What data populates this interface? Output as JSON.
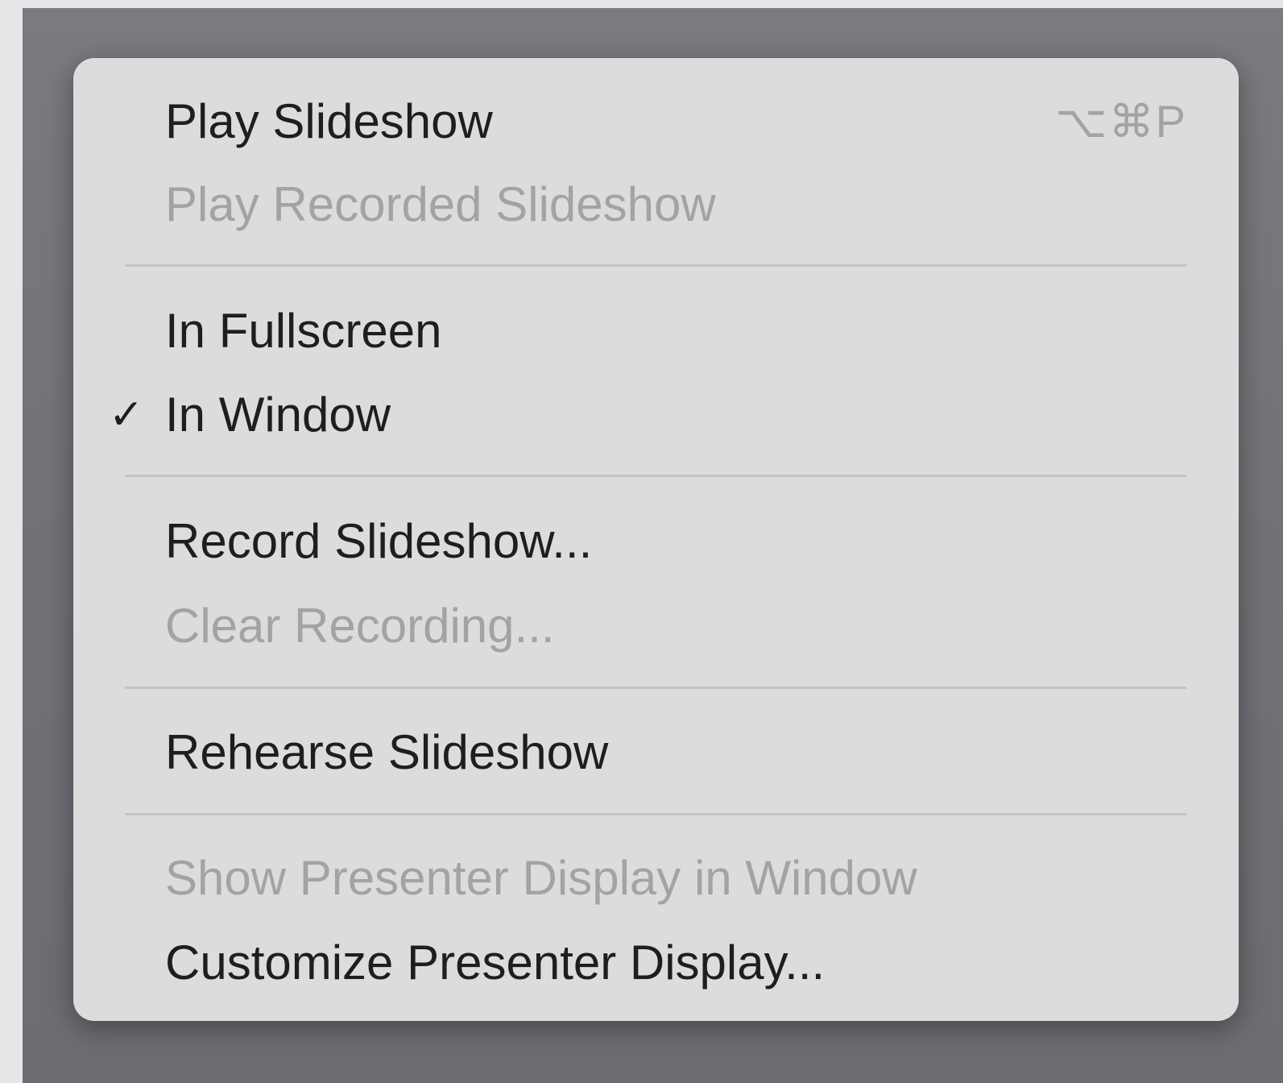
{
  "menu": {
    "items": [
      {
        "label": "Play Slideshow",
        "shortcut": "⌥⌘P",
        "enabled": true
      },
      {
        "label": "Play Recorded Slideshow",
        "enabled": false
      },
      {
        "label": "In Fullscreen",
        "enabled": true,
        "checked": false
      },
      {
        "label": "In Window",
        "enabled": true,
        "checked": true,
        "check_mark": "✓"
      },
      {
        "label": "Record Slideshow...",
        "enabled": true
      },
      {
        "label": "Clear Recording...",
        "enabled": false
      },
      {
        "label": "Rehearse Slideshow",
        "enabled": true
      },
      {
        "label": "Show Presenter Display in Window",
        "enabled": false
      },
      {
        "label": "Customize Presenter Display...",
        "enabled": true
      }
    ]
  }
}
